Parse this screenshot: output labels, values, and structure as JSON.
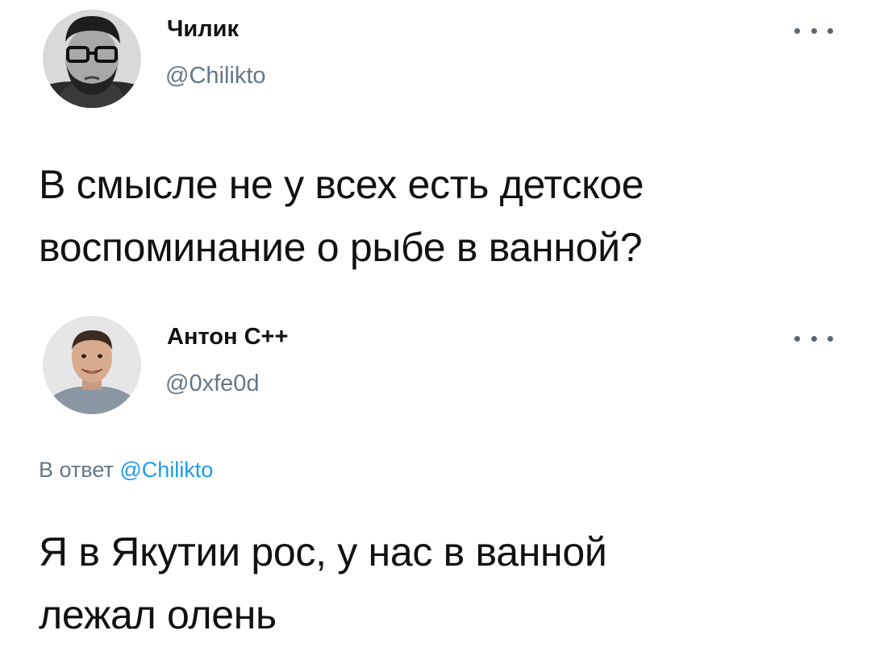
{
  "tweets": [
    {
      "author": {
        "name": "Чилик",
        "handle": "@Chilikto",
        "avatar_icon": "bearded-man-glasses-avatar"
      },
      "text_lines": [
        "В смысле не у всех есть детское",
        "воспоминание о рыбе в ванной?"
      ]
    },
    {
      "author": {
        "name": "Антон C++",
        "handle": "@0xfe0d",
        "avatar_icon": "smiling-man-avatar"
      },
      "reply_prefix": "В ответ",
      "reply_mention": "@Chilikto",
      "text_lines": [
        "Я в Якутии рос, у нас в ванной",
        "лежал олень"
      ]
    }
  ],
  "colors": {
    "text": "#111111",
    "secondary": "#657786",
    "link": "#1d9bf0"
  }
}
